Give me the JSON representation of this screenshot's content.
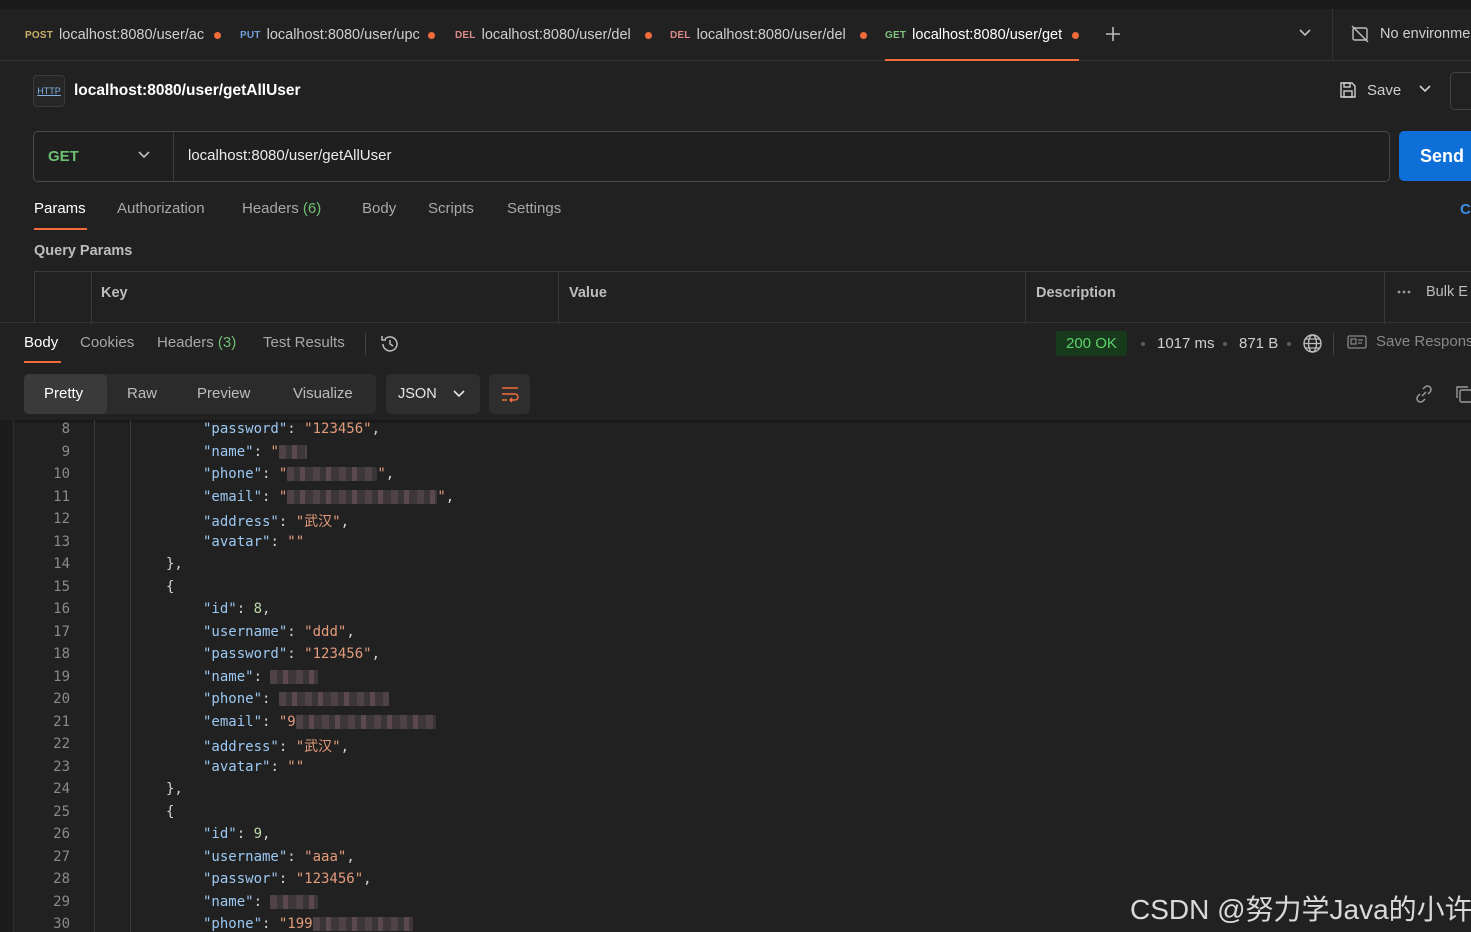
{
  "tabs": [
    {
      "method": "POST",
      "url": "localhost:8080/user/ac",
      "active": false
    },
    {
      "method": "PUT",
      "url": "localhost:8080/user/upc",
      "active": false
    },
    {
      "method": "DEL",
      "url": "localhost:8080/user/del",
      "active": false
    },
    {
      "method": "DEL",
      "url": "localhost:8080/user/del",
      "active": false
    },
    {
      "method": "GET",
      "url": "localhost:8080/user/get",
      "active": true
    }
  ],
  "environment": {
    "label": "No environme"
  },
  "request": {
    "icon_text": "HTTP",
    "title": "localhost:8080/user/getAllUser",
    "save_label": "Save",
    "method": "GET",
    "url": "localhost:8080/user/getAllUser",
    "send_label": "Send",
    "cookies_label": "C"
  },
  "request_tabs": {
    "params": "Params",
    "authorization": "Authorization",
    "headers": "Headers",
    "headers_count": "(6)",
    "body": "Body",
    "scripts": "Scripts",
    "settings": "Settings"
  },
  "query_params": {
    "title": "Query Params",
    "columns": {
      "key": "Key",
      "value": "Value",
      "description": "Description"
    },
    "bulk_label": "Bulk E"
  },
  "response_tabs": {
    "body": "Body",
    "cookies": "Cookies",
    "headers": "Headers",
    "headers_count": "(3)",
    "test_results": "Test Results"
  },
  "response_meta": {
    "status": "200 OK",
    "time": "1017 ms",
    "size": "871 B",
    "save_response": "Save Respons"
  },
  "view_modes": {
    "pretty": "Pretty",
    "raw": "Raw",
    "preview": "Preview",
    "visualize": "Visualize"
  },
  "format": "JSON",
  "code_lines": [
    {
      "n": "8",
      "text": "\"password\": \"123456\","
    },
    {
      "n": "9",
      "text": "\"name\": \""
    },
    {
      "n": "10",
      "text": "\"phone\": \""
    },
    {
      "n": "11",
      "text": "\"email\": \""
    },
    {
      "n": "12",
      "text": "\"address\": \"武汉\","
    },
    {
      "n": "13",
      "text": "\"avatar\": \"\""
    },
    {
      "n": "14",
      "text": "},"
    },
    {
      "n": "15",
      "text": "{"
    },
    {
      "n": "16",
      "text": "\"id\": 8,"
    },
    {
      "n": "17",
      "text": "\"username\": \"ddd\","
    },
    {
      "n": "18",
      "text": "\"password\": \"123456\","
    },
    {
      "n": "19",
      "text": "\"name\": "
    },
    {
      "n": "20",
      "text": "\"phone\": "
    },
    {
      "n": "21",
      "text": "\"email\": \"9"
    },
    {
      "n": "22",
      "text": "\"address\": \"武汉\","
    },
    {
      "n": "23",
      "text": "\"avatar\": \"\""
    },
    {
      "n": "24",
      "text": "},"
    },
    {
      "n": "25",
      "text": "{"
    },
    {
      "n": "26",
      "text": "\"id\": 9,"
    },
    {
      "n": "27",
      "text": "\"username\": \"aaa\","
    },
    {
      "n": "28",
      "text": "\"passwor\": \"123456\","
    },
    {
      "n": "29",
      "text": "\"name\": "
    },
    {
      "n": "30",
      "text": "\"phone\": \"199"
    }
  ],
  "watermark": "CSDN @努力学Java的小许"
}
